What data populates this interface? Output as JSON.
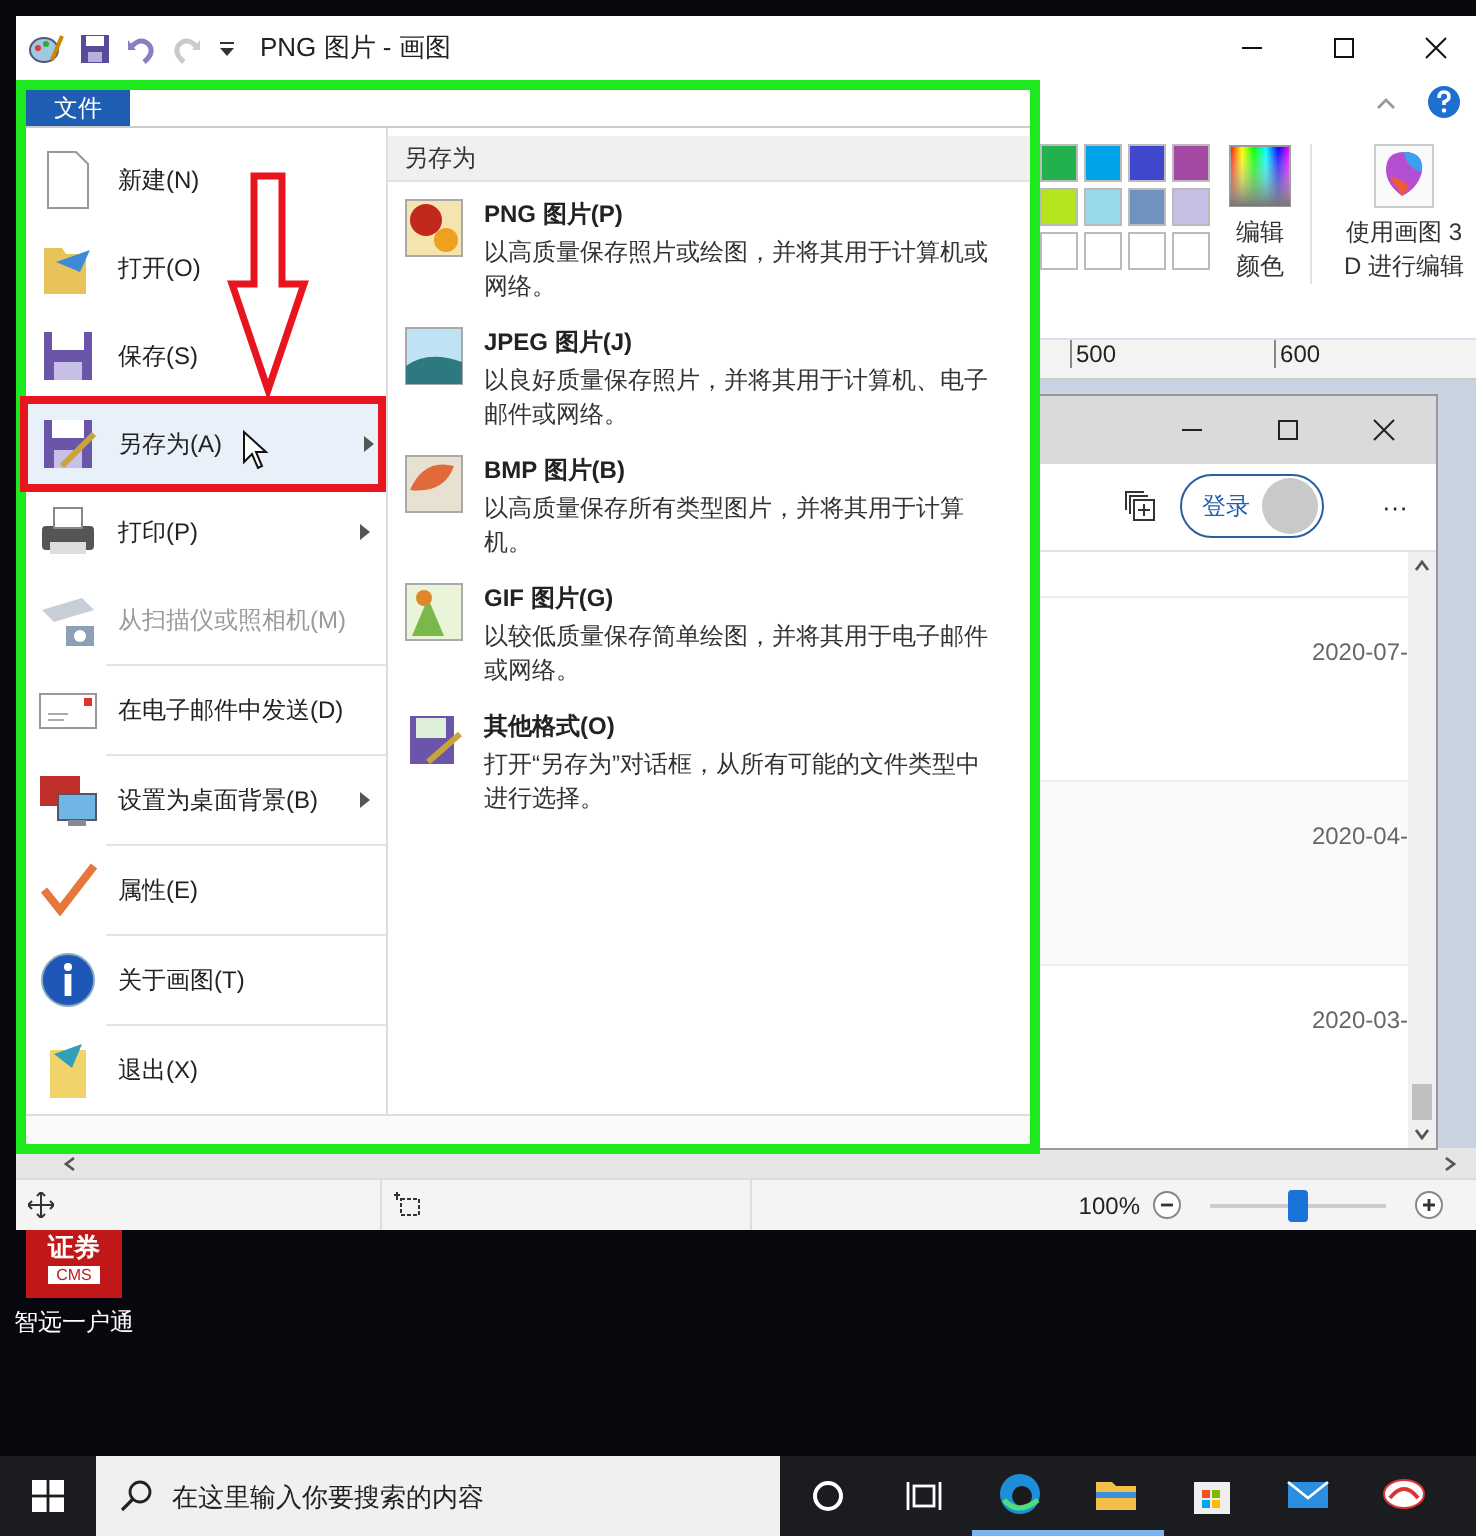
{
  "title_bar": {
    "title": "PNG 图片 - 画图"
  },
  "ribbon": {
    "palette": [
      {
        "color": "#22b14c"
      },
      {
        "color": "#00a2e8"
      },
      {
        "color": "#3f48cc"
      },
      {
        "color": "#a349a4"
      },
      {
        "color": "#b5e61d"
      },
      {
        "color": "#99d9ea"
      },
      {
        "color": "#7092be"
      },
      {
        "color": "#c8bfe7"
      },
      {
        "color": "#ffffff"
      },
      {
        "color": "#ffffff"
      },
      {
        "color": "#ffffff"
      },
      {
        "color": "#ffffff"
      }
    ],
    "edit_colors": "编辑颜色",
    "paint3d": "使用画图 3D 进行编辑"
  },
  "ruler": {
    "ticks": [
      "500",
      "600"
    ]
  },
  "file_menu": {
    "tab": {
      "label": "文件",
      "selected": true
    },
    "groups": [
      {
        "items": [
          {
            "label": "新建(N)",
            "selected": false,
            "disabled": false,
            "submenu": false
          },
          {
            "label": "打开(O)",
            "selected": false,
            "disabled": false,
            "submenu": false
          },
          {
            "label": "保存(S)",
            "selected": false,
            "disabled": false,
            "submenu": false
          },
          {
            "label": "另存为(A)",
            "selected": true,
            "disabled": false,
            "submenu": true
          },
          {
            "label": "打印(P)",
            "selected": false,
            "disabled": false,
            "submenu": true
          },
          {
            "label": "从扫描仪或照相机(M)",
            "selected": false,
            "disabled": true,
            "submenu": false
          }
        ]
      },
      {
        "items": [
          {
            "label": "在电子邮件中发送(D)",
            "selected": false,
            "disabled": false,
            "submenu": false
          }
        ]
      },
      {
        "items": [
          {
            "label": "设置为桌面背景(B)",
            "selected": false,
            "disabled": false,
            "submenu": true
          }
        ]
      },
      {
        "items": [
          {
            "label": "属性(E)",
            "selected": false,
            "disabled": false,
            "submenu": false
          }
        ]
      },
      {
        "items": [
          {
            "label": "关于画图(T)",
            "selected": false,
            "disabled": false,
            "submenu": false
          }
        ]
      },
      {
        "items": [
          {
            "label": "退出(X)",
            "selected": false,
            "disabled": false,
            "submenu": false
          }
        ]
      }
    ],
    "submenu": {
      "header": "另存为",
      "entries": [
        {
          "title": "PNG 图片(P)",
          "description": "以高质量保存照片或绘图，并将其用于计算机或网络。"
        },
        {
          "title": "JPEG 图片(J)",
          "description": "以良好质量保存照片，并将其用于计算机、电子邮件或网络。"
        },
        {
          "title": "BMP 图片(B)",
          "description": "以高质量保存所有类型图片，并将其用于计算机。"
        },
        {
          "title": "GIF 图片(G)",
          "description": "以较低质量保存简单绘图，并将其用于电子邮件或网络。"
        },
        {
          "title": "其他格式(O)",
          "description": "打开“另存为”对话框，从所有可能的文件类型中进行选择。"
        }
      ]
    }
  },
  "browser": {
    "login": "登录",
    "more": "···",
    "dates": [
      "2020-07-",
      "2020-04-",
      "2020-03-"
    ]
  },
  "status_bar": {
    "zoom": "100%",
    "zoom_slider": {
      "level": 0.5
    }
  },
  "desktop": {
    "icon": {
      "badge_text": "证券",
      "badge_sub": "CMS",
      "label": "智远一户通"
    }
  },
  "taskbar": {
    "search": {
      "placeholder": "在这里输入你要搜索的内容"
    },
    "apps": [
      {
        "running": true
      },
      {
        "running": true
      },
      {
        "running": false
      },
      {
        "running": false
      },
      {
        "running": false
      }
    ]
  }
}
